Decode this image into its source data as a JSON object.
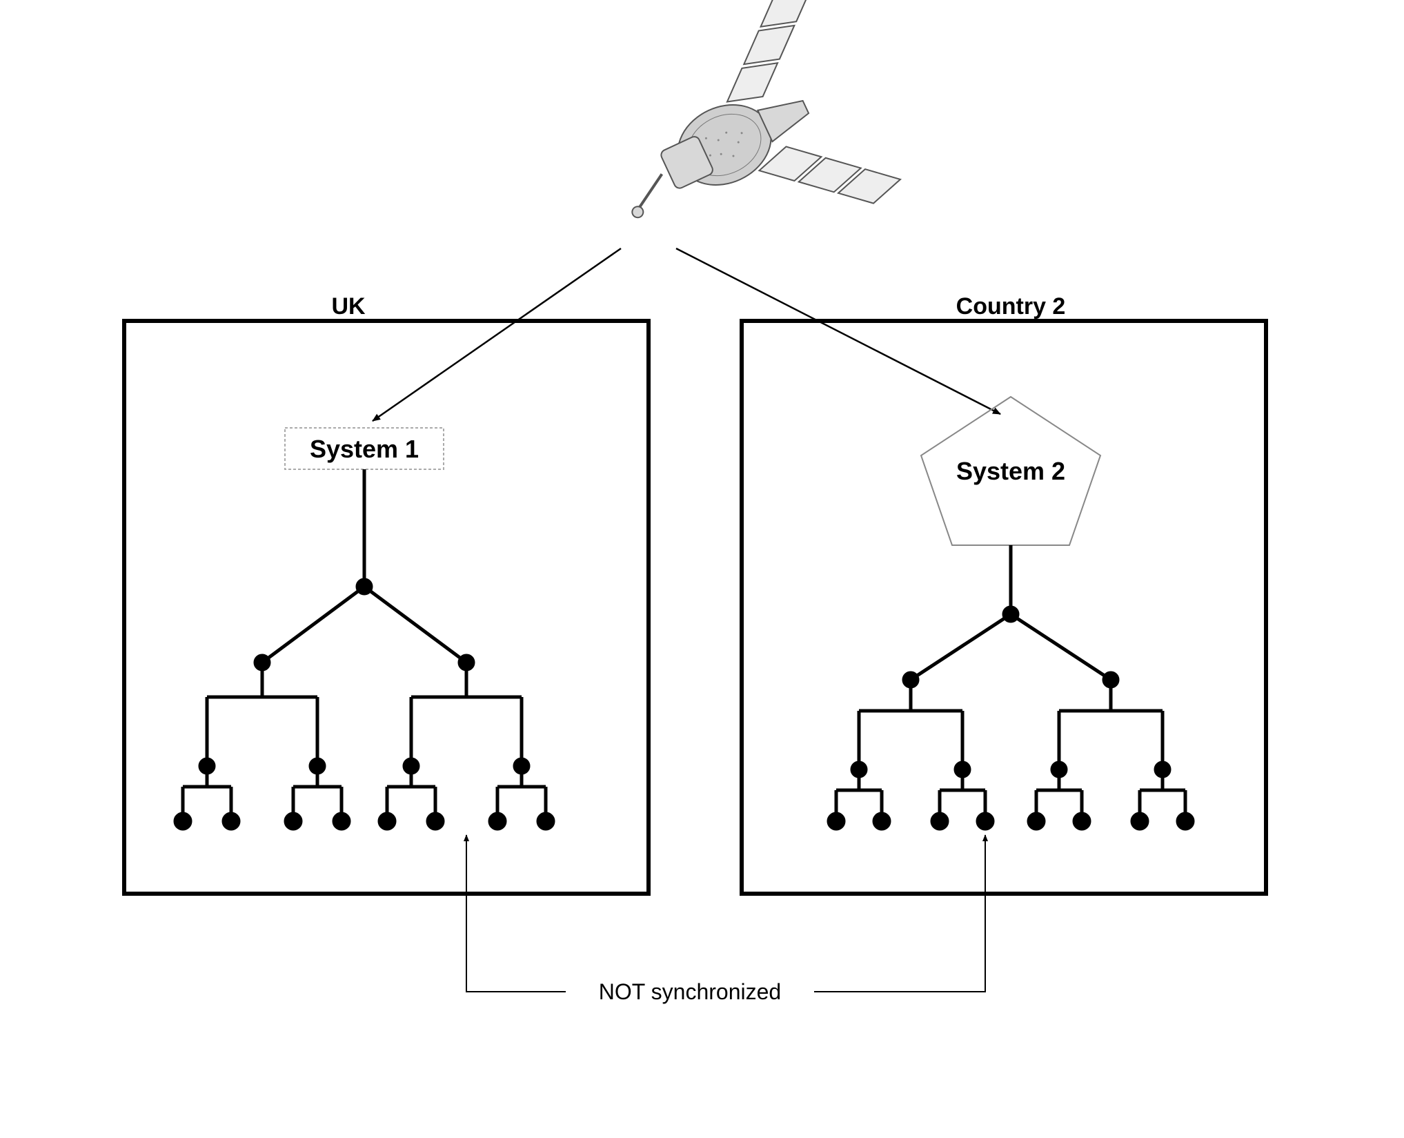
{
  "diagram": {
    "left_box_title": "UK",
    "right_box_title": "Country 2",
    "system1_label": "System 1",
    "system2_label": "System 2",
    "footer_note": "NOT synchronized",
    "satellite_name": "satellite"
  }
}
